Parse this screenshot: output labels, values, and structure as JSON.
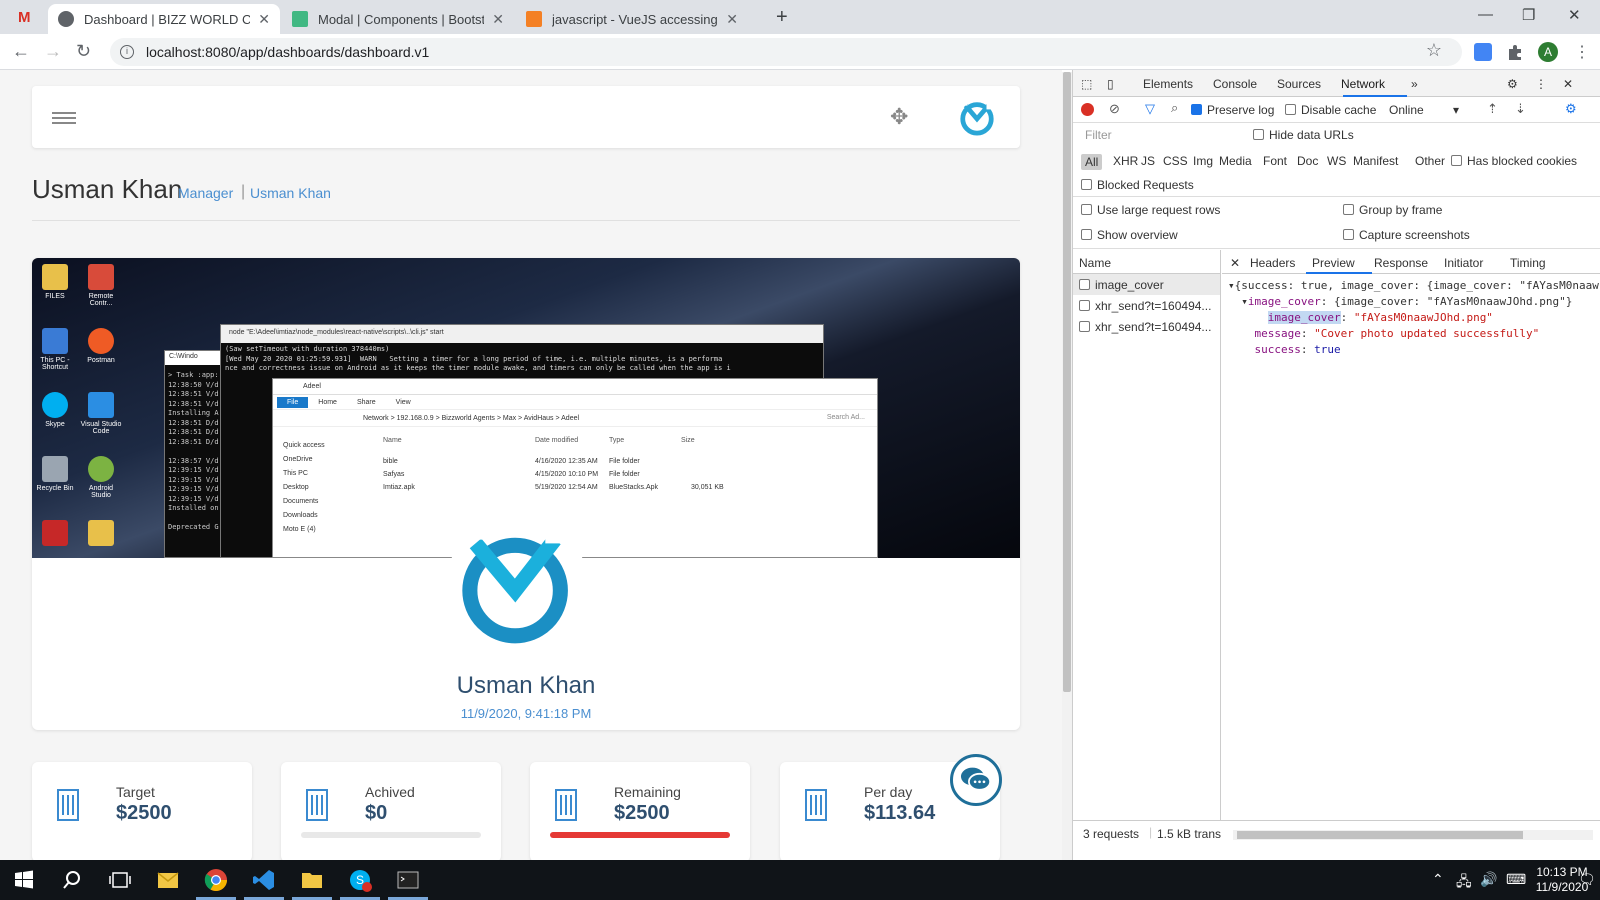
{
  "browser": {
    "tabs": [
      {
        "label": "Dashboard | BIZZ WORLD COMM",
        "active": true
      },
      {
        "label": "Modal | Components | Bootstrap"
      },
      {
        "label": "javascript - VueJS accessing exter"
      }
    ],
    "url": "localhost:8080/app/dashboards/dashboard.v1",
    "profile_initial": "A"
  },
  "page": {
    "title": "Usman Khan",
    "breadcrumb": [
      "Manager",
      "Usman Khan"
    ],
    "profile_name": "Usman Khan",
    "profile_datetime": "11/9/2020, 9:41:18 PM",
    "cover": {
      "desktop_icons": [
        "FILES",
        "Remote Contr...",
        "This PC - Shortcut",
        "Postman",
        "Skype",
        "Visual Studio Code",
        "Recycle Bin",
        "Android Studio"
      ],
      "terminal_title": "node \"E:\\Adeel\\imtiaz\\node_modules\\react-native\\scripts\\..\\cli.js\" start",
      "terminal_lines": [
        "(Saw setTimeout with duration 378440ms)",
        "[Wed May 20 2020 01:25:59.931]  WARN   Setting a timer for a long period of time, i.e. multiple minutes, is a performa",
        "nce and correctness issue on Android as it keeps the timer module awake, and timers can only be called when the app is i"
      ],
      "terminal2_title": "C:\\Windo",
      "terminal2_lines": [
        "> Task :app:",
        "12:38:50 V/d",
        "12:38:51 V/d",
        "12:38:51 V/d",
        "Installing A",
        "12:38:51 D/d",
        "12:38:51 D/d",
        "12:38:51 D/d",
        "",
        "12:38:57 V/d",
        "12:39:15 V/d",
        "12:39:15 V/d",
        "12:39:15 V/d",
        "12:39:15 V/d",
        "Installed on",
        "",
        "Deprecated G"
      ],
      "explorer_title": "Adeel",
      "explorer_ribbon": [
        "File",
        "Home",
        "Share",
        "View"
      ],
      "explorer_path": "Network  >  192.168.0.9  >  Bizzworld Agents  >  Max  >  AvidHaus  >  Adeel",
      "explorer_search": "Search Ad...",
      "explorer_nav": [
        "Quick access",
        "OneDrive",
        "This PC",
        "Desktop",
        "Documents",
        "Downloads",
        "Moto E (4)"
      ],
      "explorer_columns": [
        "Name",
        "Date modified",
        "Type",
        "Size"
      ],
      "explorer_files": [
        {
          "name": "bible",
          "date": "4/16/2020 12:35 AM",
          "type": "File folder",
          "size": ""
        },
        {
          "name": "Safyas",
          "date": "4/15/2020 10:10 PM",
          "type": "File folder",
          "size": ""
        },
        {
          "name": "Imtiaz.apk",
          "date": "5/19/2020 12:54 AM",
          "type": "BlueStacks.Apk",
          "size": "30,051 KB"
        }
      ]
    },
    "stats": [
      {
        "label": "Target",
        "value": "$2500"
      },
      {
        "label": "Achived",
        "value": "$0",
        "progress": 0
      },
      {
        "label": "Remaining",
        "value": "$2500",
        "progress": 1
      },
      {
        "label": "Per day",
        "value": "$113.64"
      }
    ]
  },
  "devtools": {
    "tabs": [
      "Elements",
      "Console",
      "Sources",
      "Network"
    ],
    "active_tab": "Network",
    "preserve_log": "Preserve log",
    "disable_cache": "Disable cache",
    "throttle": "Online",
    "filter_placeholder": "Filter",
    "hide_data_urls": "Hide data URLs",
    "types": [
      "All",
      "XHR",
      "JS",
      "CSS",
      "Img",
      "Media",
      "Font",
      "Doc",
      "WS",
      "Manifest",
      "Other"
    ],
    "has_blocked_cookies": "Has blocked cookies",
    "blocked_requests": "Blocked Requests",
    "large_rows": "Use large request rows",
    "group_by_frame": "Group by frame",
    "show_overview": "Show overview",
    "capture_screenshots": "Capture screenshots",
    "name_header": "Name",
    "requests": [
      "image_cover",
      "xhr_send?t=160494...",
      "xhr_send?t=160494..."
    ],
    "detail_tabs": [
      "Headers",
      "Preview",
      "Response",
      "Initiator",
      "Timing"
    ],
    "preview": {
      "line1": "{success: true, image_cover: {image_cover: \"fAYasM0naaw",
      "line2_key": "image_cover",
      "line2_val": "{image_cover: \"fAYasM0naawJOhd.png\"}",
      "line3_key": "image_cover",
      "line3_val": "\"fAYasM0naawJOhd.png\"",
      "line4_key": "message",
      "line4_val": "\"Cover photo updated successfully\"",
      "line5_key": "success",
      "line5_val": "true"
    },
    "status_requests": "3 requests",
    "status_transfer": "1.5 kB trans"
  },
  "taskbar": {
    "time": "10:13 PM",
    "date": "11/9/2020"
  },
  "colors": {
    "accent": "#4b8fd0",
    "title": "#2f4f6f",
    "remaining_bar": "#e53935",
    "devtools_accent": "#1a73e8"
  }
}
